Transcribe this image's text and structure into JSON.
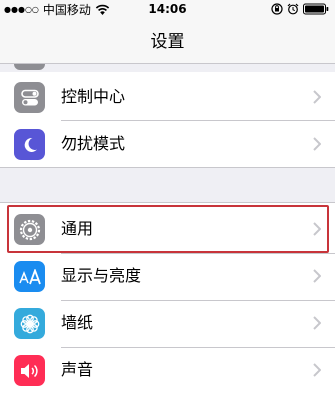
{
  "status_bar": {
    "signal": "●●●○○",
    "carrier": "中国移动",
    "time": "14:06"
  },
  "nav": {
    "title": "设置"
  },
  "group_a": [
    {
      "label": "控制中心",
      "icon": "toggles-icon",
      "color": "#8e8e93"
    },
    {
      "label": "勿扰模式",
      "icon": "moon-icon",
      "color": "#5856d6"
    }
  ],
  "group_b": [
    {
      "label": "通用",
      "icon": "gear-icon",
      "color": "#8e8e93"
    },
    {
      "label": "显示与亮度",
      "icon": "text-size-icon",
      "color": "#1a8cf0"
    },
    {
      "label": "墙纸",
      "icon": "flower-icon",
      "color": "#34aadc"
    },
    {
      "label": "声音",
      "icon": "speaker-icon",
      "color": "#ff2d55"
    }
  ],
  "highlight_color": "#c8343a"
}
